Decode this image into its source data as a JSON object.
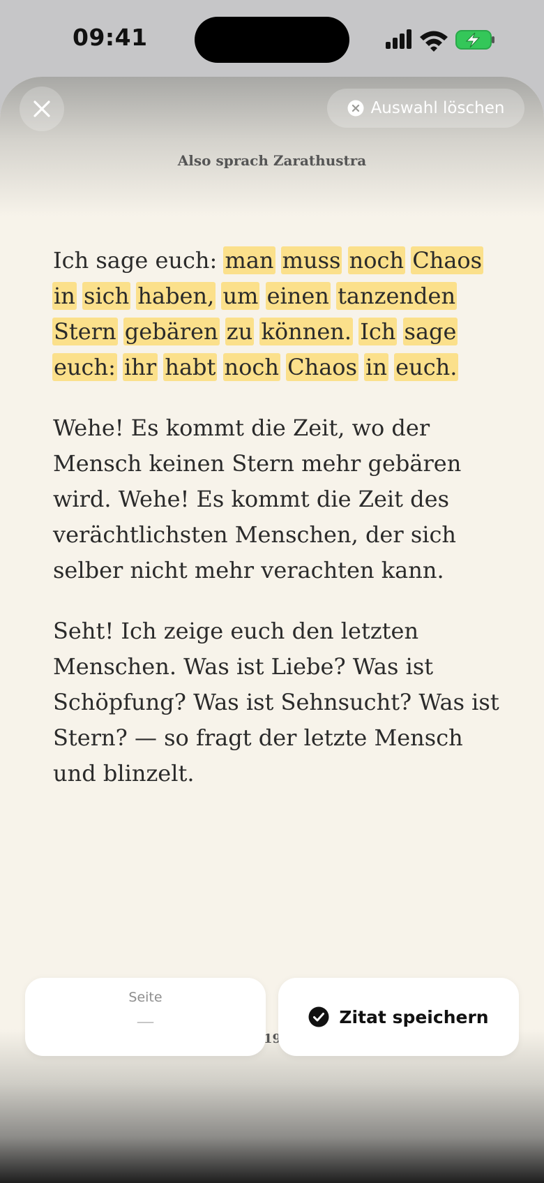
{
  "status_bar": {
    "time": "09:41"
  },
  "header": {
    "clear_selection_label": "Auswahl löschen",
    "book_title": "Also sprach Zarathustra"
  },
  "reading": {
    "paragraph_1": {
      "plain": "Ich sage euch: ",
      "highlighted": [
        "man",
        "muss",
        "noch",
        "Chaos",
        "in",
        "sich",
        "haben,",
        "um",
        "einen",
        "tanzenden",
        "Stern",
        "gebären",
        "zu",
        "können.",
        "Ich",
        "sage",
        "euch:",
        "ihr",
        "habt",
        "noch",
        "Chaos",
        "in",
        "euch."
      ]
    },
    "paragraph_2": "Wehe! Es kommt die Zeit, wo der Mensch keinen Stern mehr gebären wird. Wehe! Es kommt die Zeit des verächtlichsten Menschen, der sich selber nicht mehr verachten kann.",
    "paragraph_3": "Seht! Ich zeige euch den letzten Menschen. Was ist Liebe? Was ist Schöpfung? Was ist Sehnsucht? Was ist Stern? — so fragt der letzte Mensch und blinzelt."
  },
  "bottom_bar": {
    "page_label": "Seite",
    "page_placeholder": "—",
    "page_number_partial": "19",
    "save_label": "Zitat speichern"
  },
  "colors": {
    "highlight": "#fbe08b",
    "page_background": "#f7f3ea",
    "battery_green": "#34c759"
  },
  "icons": {
    "close": "close-icon",
    "clear": "clear-circle-icon",
    "save": "check-circle-icon",
    "signal": "signal-icon",
    "wifi": "wifi-icon",
    "battery": "battery-charging-icon"
  }
}
